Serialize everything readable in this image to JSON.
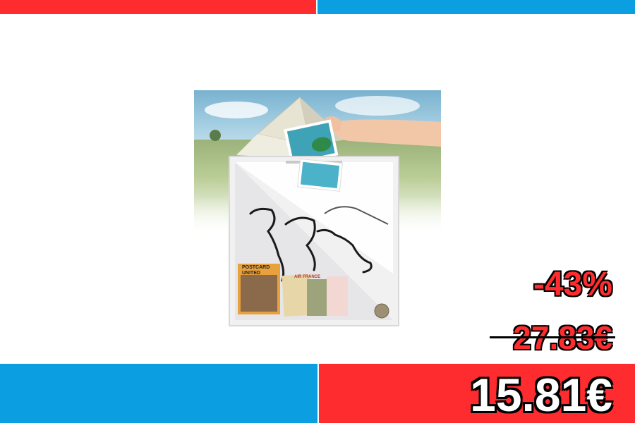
{
  "colors": {
    "red": "#fe2c2f",
    "blue": "#0b9ee0"
  },
  "price": {
    "discount": "-43%",
    "old": "27.83€",
    "new": "15.81€"
  },
  "product_image": {
    "postcard_text": "POSTCARD\nUNITED",
    "ticket_text": "AIR FRANCE"
  }
}
